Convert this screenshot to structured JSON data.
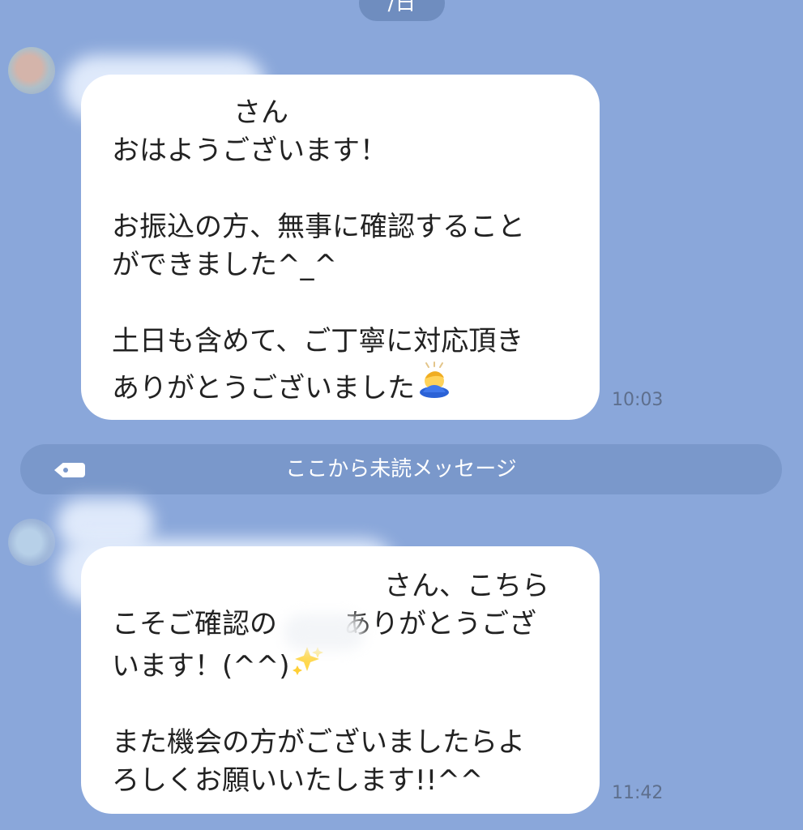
{
  "date_label": "/日",
  "unread_label": "ここから未読メッセージ",
  "messages": [
    {
      "time": "10:03",
      "lines": [
        "さん",
        "おはようございます！",
        "",
        "お振込の方、無事に確認すること",
        "ができました^_^",
        "",
        "土日も含めて、ご丁寧に対応頂き",
        "ありがとうございました"
      ]
    },
    {
      "time": "11:42",
      "lines": [
        "さん、こちら",
        "こそご確認の",
        "ありがとうござ",
        "います！(^^)",
        "",
        "また機会の方がございましたらよ",
        "ろしくお願いいたします!!^^"
      ]
    }
  ],
  "icons": {
    "bow": "person-bowing-icon",
    "sparkles": "sparkles-icon",
    "unread": "tag-icon"
  },
  "colors": {
    "background": "#8aa7da",
    "bubble": "#ffffff",
    "unread_bar": "#7a98cb",
    "time": "#5e6f8d"
  }
}
